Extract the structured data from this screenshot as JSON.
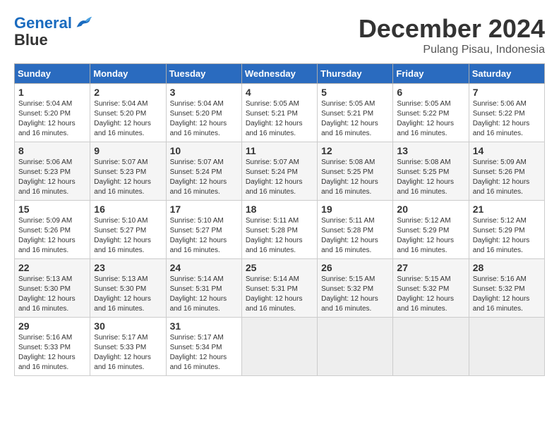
{
  "header": {
    "logo_line1": "General",
    "logo_line2": "Blue",
    "month": "December 2024",
    "location": "Pulang Pisau, Indonesia"
  },
  "weekdays": [
    "Sunday",
    "Monday",
    "Tuesday",
    "Wednesday",
    "Thursday",
    "Friday",
    "Saturday"
  ],
  "weeks": [
    [
      {
        "day": "1",
        "sunrise": "5:04 AM",
        "sunset": "5:20 PM",
        "daylight": "12 hours and 16 minutes."
      },
      {
        "day": "2",
        "sunrise": "5:04 AM",
        "sunset": "5:20 PM",
        "daylight": "12 hours and 16 minutes."
      },
      {
        "day": "3",
        "sunrise": "5:04 AM",
        "sunset": "5:20 PM",
        "daylight": "12 hours and 16 minutes."
      },
      {
        "day": "4",
        "sunrise": "5:05 AM",
        "sunset": "5:21 PM",
        "daylight": "12 hours and 16 minutes."
      },
      {
        "day": "5",
        "sunrise": "5:05 AM",
        "sunset": "5:21 PM",
        "daylight": "12 hours and 16 minutes."
      },
      {
        "day": "6",
        "sunrise": "5:05 AM",
        "sunset": "5:22 PM",
        "daylight": "12 hours and 16 minutes."
      },
      {
        "day": "7",
        "sunrise": "5:06 AM",
        "sunset": "5:22 PM",
        "daylight": "12 hours and 16 minutes."
      }
    ],
    [
      {
        "day": "8",
        "sunrise": "5:06 AM",
        "sunset": "5:23 PM",
        "daylight": "12 hours and 16 minutes."
      },
      {
        "day": "9",
        "sunrise": "5:07 AM",
        "sunset": "5:23 PM",
        "daylight": "12 hours and 16 minutes."
      },
      {
        "day": "10",
        "sunrise": "5:07 AM",
        "sunset": "5:24 PM",
        "daylight": "12 hours and 16 minutes."
      },
      {
        "day": "11",
        "sunrise": "5:07 AM",
        "sunset": "5:24 PM",
        "daylight": "12 hours and 16 minutes."
      },
      {
        "day": "12",
        "sunrise": "5:08 AM",
        "sunset": "5:25 PM",
        "daylight": "12 hours and 16 minutes."
      },
      {
        "day": "13",
        "sunrise": "5:08 AM",
        "sunset": "5:25 PM",
        "daylight": "12 hours and 16 minutes."
      },
      {
        "day": "14",
        "sunrise": "5:09 AM",
        "sunset": "5:26 PM",
        "daylight": "12 hours and 16 minutes."
      }
    ],
    [
      {
        "day": "15",
        "sunrise": "5:09 AM",
        "sunset": "5:26 PM",
        "daylight": "12 hours and 16 minutes."
      },
      {
        "day": "16",
        "sunrise": "5:10 AM",
        "sunset": "5:27 PM",
        "daylight": "12 hours and 16 minutes."
      },
      {
        "day": "17",
        "sunrise": "5:10 AM",
        "sunset": "5:27 PM",
        "daylight": "12 hours and 16 minutes."
      },
      {
        "day": "18",
        "sunrise": "5:11 AM",
        "sunset": "5:28 PM",
        "daylight": "12 hours and 16 minutes."
      },
      {
        "day": "19",
        "sunrise": "5:11 AM",
        "sunset": "5:28 PM",
        "daylight": "12 hours and 16 minutes."
      },
      {
        "day": "20",
        "sunrise": "5:12 AM",
        "sunset": "5:29 PM",
        "daylight": "12 hours and 16 minutes."
      },
      {
        "day": "21",
        "sunrise": "5:12 AM",
        "sunset": "5:29 PM",
        "daylight": "12 hours and 16 minutes."
      }
    ],
    [
      {
        "day": "22",
        "sunrise": "5:13 AM",
        "sunset": "5:30 PM",
        "daylight": "12 hours and 16 minutes."
      },
      {
        "day": "23",
        "sunrise": "5:13 AM",
        "sunset": "5:30 PM",
        "daylight": "12 hours and 16 minutes."
      },
      {
        "day": "24",
        "sunrise": "5:14 AM",
        "sunset": "5:31 PM",
        "daylight": "12 hours and 16 minutes."
      },
      {
        "day": "25",
        "sunrise": "5:14 AM",
        "sunset": "5:31 PM",
        "daylight": "12 hours and 16 minutes."
      },
      {
        "day": "26",
        "sunrise": "5:15 AM",
        "sunset": "5:32 PM",
        "daylight": "12 hours and 16 minutes."
      },
      {
        "day": "27",
        "sunrise": "5:15 AM",
        "sunset": "5:32 PM",
        "daylight": "12 hours and 16 minutes."
      },
      {
        "day": "28",
        "sunrise": "5:16 AM",
        "sunset": "5:32 PM",
        "daylight": "12 hours and 16 minutes."
      }
    ],
    [
      {
        "day": "29",
        "sunrise": "5:16 AM",
        "sunset": "5:33 PM",
        "daylight": "12 hours and 16 minutes."
      },
      {
        "day": "30",
        "sunrise": "5:17 AM",
        "sunset": "5:33 PM",
        "daylight": "12 hours and 16 minutes."
      },
      {
        "day": "31",
        "sunrise": "5:17 AM",
        "sunset": "5:34 PM",
        "daylight": "12 hours and 16 minutes."
      },
      null,
      null,
      null,
      null
    ]
  ],
  "labels": {
    "sunrise": "Sunrise:",
    "sunset": "Sunset:",
    "daylight": "Daylight:"
  }
}
